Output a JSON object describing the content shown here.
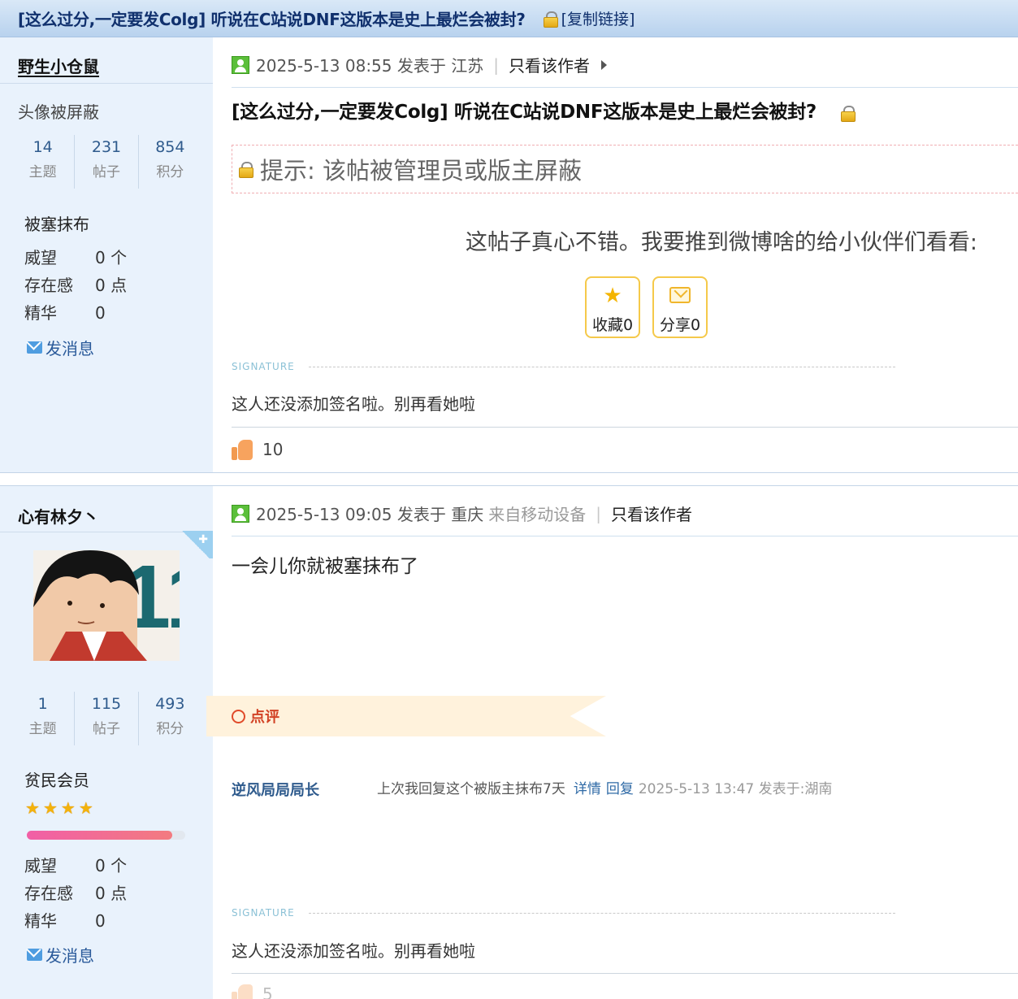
{
  "thread": {
    "title": "[这么过分,一定要发Colg] 听说在C站说DNF这版本是史上最烂会被封?",
    "copy_link": "[复制链接]"
  },
  "post1": {
    "author": "野生小仓鼠",
    "avatar_hidden": "头像被屏蔽",
    "stats": [
      {
        "num": "14",
        "label": "主题"
      },
      {
        "num": "231",
        "label": "帖子"
      },
      {
        "num": "854",
        "label": "积分"
      }
    ],
    "group": "被塞抹布",
    "info": [
      {
        "k": "威望",
        "v": "0 个"
      },
      {
        "k": "存在感",
        "v": "0 点"
      },
      {
        "k": "精华",
        "v": "0"
      }
    ],
    "send_msg": "发消息",
    "time": "2025-5-13 08:55 发表于 江苏",
    "only_author": "只看该作者",
    "title": "[这么过分,一定要发Colg] 听说在C站说DNF这版本是史上最烂会被封?",
    "notice": "提示: 该帖被管理员或版主屏蔽",
    "share_prompt": "这帖子真心不错。我要推到微博啥的给小伙伴们看看:",
    "fav_button": "收藏0",
    "share_button": "分享0",
    "sig_label": "SIGNATURE",
    "signature": "这人还没添加签名啦。别再看她啦",
    "likes": "10"
  },
  "post2": {
    "author": "心有林夕丶",
    "stats": [
      {
        "num": "1",
        "label": "主题"
      },
      {
        "num": "115",
        "label": "帖子"
      },
      {
        "num": "493",
        "label": "积分"
      }
    ],
    "group": "贫民会员",
    "star_count": 4,
    "progress": 0.92,
    "info": [
      {
        "k": "威望",
        "v": "0 个"
      },
      {
        "k": "存在感",
        "v": "0 点"
      },
      {
        "k": "精华",
        "v": "0"
      }
    ],
    "send_msg": "发消息",
    "time": "2025-5-13 09:05 发表于 重庆",
    "device": "来自移动设备",
    "only_author": "只看该作者",
    "content": "一会儿你就被塞抹布了",
    "comment_header": "点评",
    "comment": {
      "user": "逆风局局局长",
      "text": "上次我回复这个被版主抹布7天",
      "detail": "详情",
      "reply": "回复",
      "meta": "2025-5-13 13:47 发表于:湖南"
    },
    "sig_label": "SIGNATURE",
    "signature": "这人还没添加签名啦。别再看她啦",
    "likes": "5"
  },
  "colors": {
    "header_bg": "#c6dcf2",
    "sidebar_bg": "#e9f2fc",
    "link": "#2f5b8d",
    "accent_red": "#d24225"
  }
}
